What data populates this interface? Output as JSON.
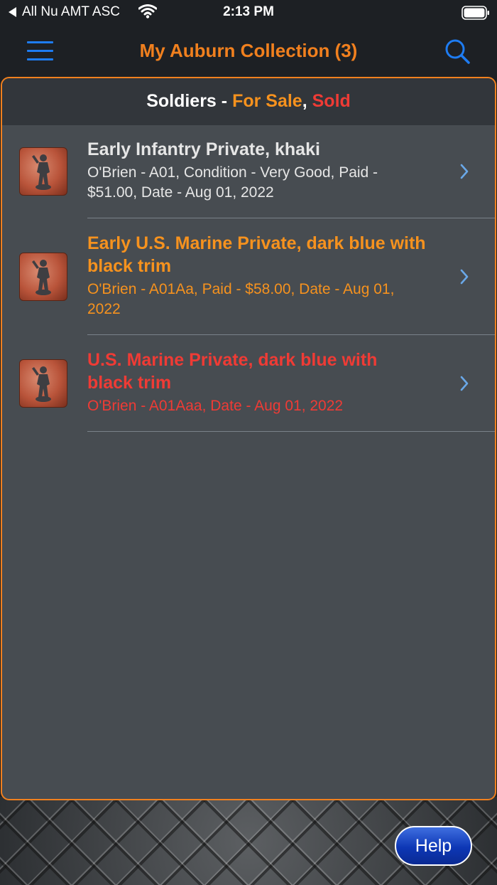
{
  "status_bar": {
    "carrier": "All Nu AMT ASC",
    "time": "2:13 PM"
  },
  "nav": {
    "title": "My Auburn Collection (3)"
  },
  "section": {
    "label": "Soldiers",
    "separator": " - ",
    "for_sale": "For Sale",
    "comma": ", ",
    "sold": "Sold"
  },
  "items": [
    {
      "title": "Early Infantry Private, khaki",
      "details": "O'Brien - A01, Condition - Very Good, Paid - $51.00, Date - Aug 01, 2022",
      "color": "#e6e6e6",
      "subcolor": "#e6e6e6"
    },
    {
      "title": "Early U.S. Marine Private, dark blue with black trim",
      "details": "O'Brien - A01Aa, Paid - $58.00, Date - Aug 01, 2022",
      "color": "#f6921e",
      "subcolor": "#f6921e"
    },
    {
      "title": "U.S. Marine Private, dark blue with black trim",
      "details": "O'Brien - A01Aaa, Date - Aug 01, 2022",
      "color": "#ef3b35",
      "subcolor": "#ef3b35"
    }
  ],
  "help": {
    "label": "Help"
  },
  "colors": {
    "accent": "#f1801e",
    "nav_icons": "#1e7cf2",
    "for_sale": "#f6921e",
    "sold": "#ef3b35"
  }
}
